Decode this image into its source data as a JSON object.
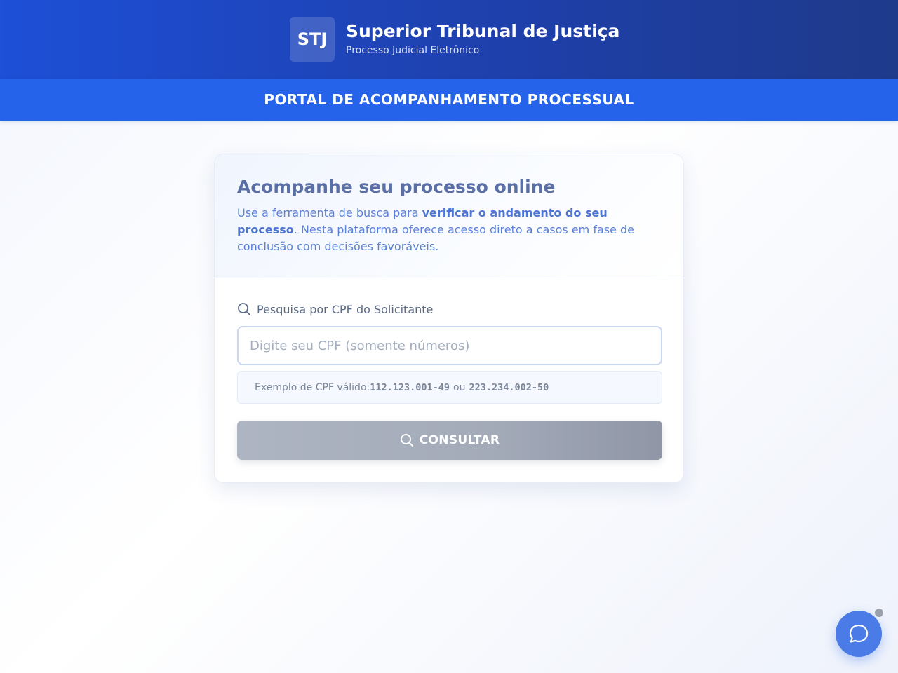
{
  "header": {
    "logo_text": "STJ",
    "title": "Superior Tribunal de Justiça",
    "subtitle": "Processo Judicial Eletrônico"
  },
  "portal": {
    "title": "PORTAL DE ACOMPANHAMENTO PROCESSUAL"
  },
  "card": {
    "title": "Acompanhe seu processo online",
    "desc_part1": "Use a ferramenta de busca para ",
    "desc_bold": "verificar o andamento do seu processo",
    "desc_part2": ". Nesta plataforma oferece acesso direto a casos em fase de conclusão com decisões favoráveis."
  },
  "search": {
    "label": "Pesquisa por CPF do Solicitante",
    "label_icon": "search-icon",
    "placeholder": "Digite seu CPF (somente números)",
    "value": "",
    "example_prefix": "Exemplo de CPF válido: ",
    "example_cpf_1": "112.123.001-49",
    "example_or": "ou",
    "example_cpf_2": "223.234.002-50",
    "button_label": "CONSULTAR",
    "button_icon": "search-icon"
  },
  "chat": {
    "icon": "chat-bubble-icon",
    "status_color": "#9aa1ad"
  },
  "colors": {
    "header_blue": "#1d4fd7",
    "portal_blue": "#2563eb",
    "button_gray": "#a3aab8",
    "chat_blue": "#4a7be6"
  }
}
